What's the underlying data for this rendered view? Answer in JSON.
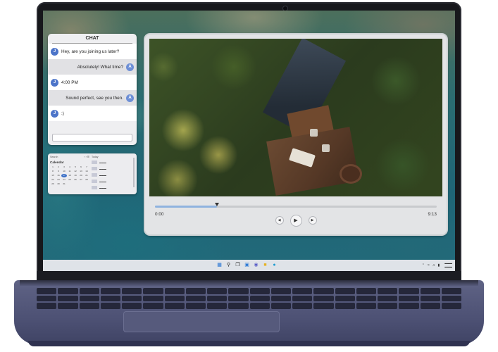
{
  "chat": {
    "title": "CHAT",
    "messages": [
      {
        "side": "left",
        "avatar": "J",
        "text": "Hey, are you joining us later?"
      },
      {
        "side": "right",
        "avatar": "A",
        "text": "Absolutely! What time?"
      },
      {
        "side": "left",
        "avatar": "J",
        "text": "4:00 PM"
      },
      {
        "side": "right",
        "avatar": "A",
        "text": "Sound perfect, see you then."
      },
      {
        "side": "left",
        "avatar": "J",
        "text": ":)"
      }
    ],
    "input_placeholder": ""
  },
  "calendar_widget": {
    "title": "Calendar",
    "search_label": "Search",
    "day_numbers": [
      "1",
      "2",
      "3",
      "4",
      "5",
      "6",
      "7",
      "8",
      "9",
      "10",
      "11",
      "12",
      "13",
      "14",
      "15",
      "16",
      "17",
      "18",
      "19",
      "20",
      "21",
      "22",
      "23",
      "24",
      "25",
      "26",
      "27",
      "28",
      "29",
      "30",
      "31"
    ],
    "today": "17",
    "side_header": "Today"
  },
  "player": {
    "progress_fraction": 0.22,
    "elapsed": "0:00",
    "duration": "9:13",
    "prev_icon": "skip-back-icon",
    "play_icon": "play-icon",
    "next_icon": "skip-forward-icon"
  },
  "taskbar": {
    "icons": [
      "windows-start-icon",
      "search-icon",
      "task-view-icon",
      "widgets-icon",
      "chat-icon",
      "file-explorer-icon",
      "edge-browser-icon"
    ],
    "tray_icons": [
      "chevron-up-icon",
      "wifi-icon",
      "volume-icon",
      "battery-icon"
    ]
  },
  "colors": {
    "avatar": "#4c74c9",
    "progress": "#8fb3df",
    "taskbar": "#dfe3e8"
  }
}
